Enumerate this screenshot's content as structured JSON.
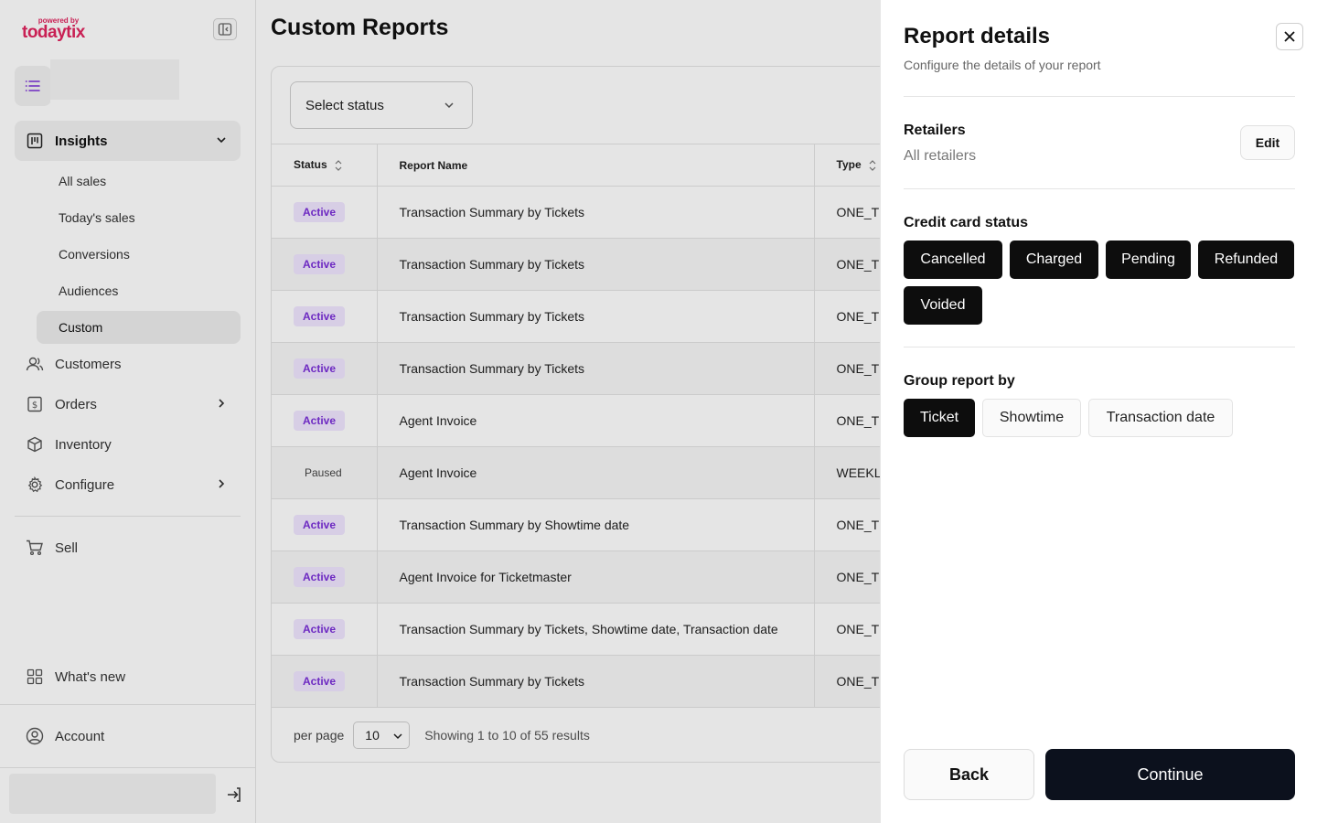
{
  "logo": {
    "powered_by": "powered by",
    "brand": "todaytix"
  },
  "sidebar": {
    "insights_label": "Insights",
    "insights_sub": [
      "All sales",
      "Today's sales",
      "Conversions",
      "Audiences",
      "Custom"
    ],
    "customers_label": "Customers",
    "orders_label": "Orders",
    "inventory_label": "Inventory",
    "configure_label": "Configure",
    "sell_label": "Sell",
    "whats_new_label": "What's new",
    "account_label": "Account"
  },
  "main": {
    "title": "Custom Reports",
    "status_filter_placeholder": "Select status",
    "columns": {
      "status": "Status",
      "name": "Report Name",
      "type": "Type"
    },
    "rows": [
      {
        "status": "Active",
        "name": "Transaction Summary by Tickets",
        "type": "ONE_TI"
      },
      {
        "status": "Active",
        "name": "Transaction Summary by Tickets",
        "type": "ONE_TI"
      },
      {
        "status": "Active",
        "name": "Transaction Summary by Tickets",
        "type": "ONE_TI"
      },
      {
        "status": "Active",
        "name": "Transaction Summary by Tickets",
        "type": "ONE_TI"
      },
      {
        "status": "Active",
        "name": "Agent Invoice",
        "type": "ONE_TI"
      },
      {
        "status": "Paused",
        "name": "Agent Invoice",
        "type": "WEEKLY"
      },
      {
        "status": "Active",
        "name": "Transaction Summary by Showtime date",
        "type": "ONE_TI"
      },
      {
        "status": "Active",
        "name": "Agent Invoice for Ticketmaster",
        "type": "ONE_TI"
      },
      {
        "status": "Active",
        "name": "Transaction Summary by Tickets, Showtime date, Transaction date",
        "type": "ONE_TI"
      },
      {
        "status": "Active",
        "name": "Transaction Summary by Tickets",
        "type": "ONE_TI"
      }
    ],
    "per_page_label": "per page",
    "per_page_value": "10",
    "results_text": "Showing 1 to 10 of 55 results"
  },
  "drawer": {
    "title": "Report details",
    "subtitle": "Configure the details of your report",
    "retailers_title": "Retailers",
    "retailers_value": "All retailers",
    "edit_label": "Edit",
    "cc_title": "Credit card status",
    "cc_options": [
      "Cancelled",
      "Charged",
      "Pending",
      "Refunded",
      "Voided"
    ],
    "group_title": "Group report by",
    "group_options": [
      "Ticket",
      "Showtime",
      "Transaction date"
    ],
    "group_selected": "Ticket",
    "back_label": "Back",
    "continue_label": "Continue"
  },
  "colors": {
    "brand": "#e0245e",
    "active_badge_bg": "#f0e6ff",
    "active_badge_text": "#7a2ed8",
    "primary_button": "#0c111d",
    "chip_selected": "#0d0d0d"
  }
}
